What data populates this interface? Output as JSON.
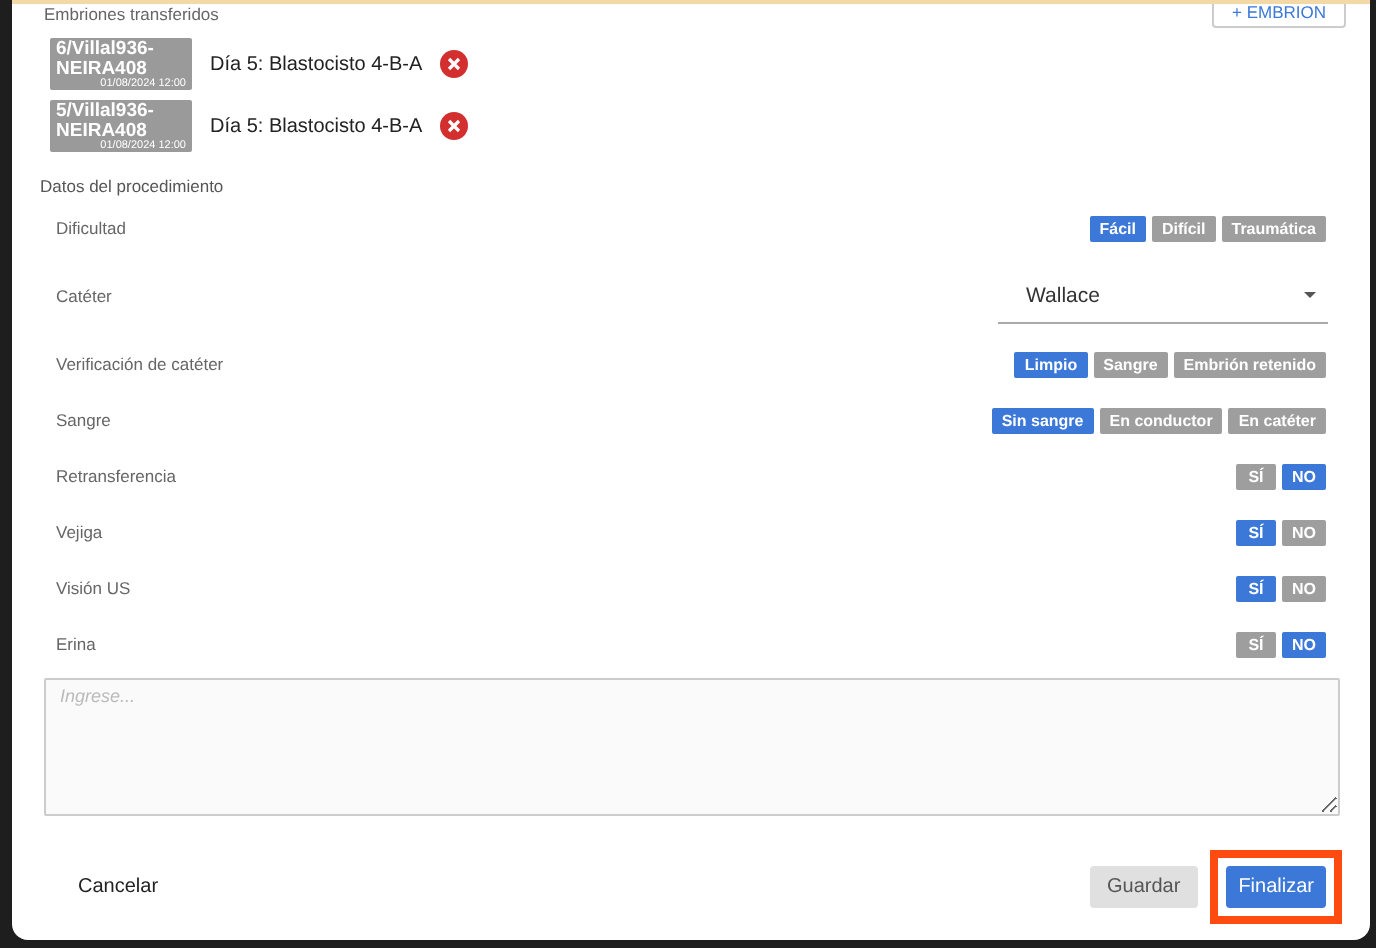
{
  "embryos_section": {
    "title": "Embriones transferidos",
    "add_button": "+ EMBRION"
  },
  "embryos": [
    {
      "code": "6/Villal936-NEIRA408",
      "date": "01/08/2024 12:00",
      "description": "Día 5: Blastocisto 4-B-A"
    },
    {
      "code": "5/Villal936-NEIRA408",
      "date": "01/08/2024 12:00",
      "description": "Día 5: Blastocisto 4-B-A"
    }
  ],
  "procedure": {
    "title": "Datos del procedimiento",
    "fields": [
      {
        "kind": "options",
        "label": "Dificultad",
        "options": [
          {
            "label": "Fácil",
            "selected": true
          },
          {
            "label": "Difícil",
            "selected": false
          },
          {
            "label": "Traumática",
            "selected": false
          }
        ]
      },
      {
        "kind": "select",
        "label": "Catéter",
        "value": "Wallace"
      },
      {
        "kind": "options",
        "label": "Verificación de catéter",
        "options": [
          {
            "label": "Limpio",
            "selected": true
          },
          {
            "label": "Sangre",
            "selected": false
          },
          {
            "label": "Embrión retenido",
            "selected": false
          }
        ]
      },
      {
        "kind": "options",
        "label": "Sangre",
        "options": [
          {
            "label": "Sin sangre",
            "selected": true
          },
          {
            "label": "En conductor",
            "selected": false
          },
          {
            "label": "En catéter",
            "selected": false
          }
        ]
      },
      {
        "kind": "options",
        "label": "Retransferencia",
        "options": [
          {
            "label": "SÍ",
            "selected": false
          },
          {
            "label": "NO",
            "selected": true
          }
        ]
      },
      {
        "kind": "options",
        "label": "Vejiga",
        "options": [
          {
            "label": "SÍ",
            "selected": true
          },
          {
            "label": "NO",
            "selected": false
          }
        ]
      },
      {
        "kind": "options",
        "label": "Visión US",
        "options": [
          {
            "label": "SÍ",
            "selected": true
          },
          {
            "label": "NO",
            "selected": false
          }
        ]
      },
      {
        "kind": "options",
        "label": "Erina",
        "options": [
          {
            "label": "SÍ",
            "selected": false
          },
          {
            "label": "NO",
            "selected": true
          }
        ]
      }
    ],
    "notes": {
      "placeholder": "Ingrese..."
    }
  },
  "footer": {
    "cancel": "Cancelar",
    "save": "Guardar",
    "finish": {
      "label": "Finalizar",
      "highlighted": true
    }
  }
}
